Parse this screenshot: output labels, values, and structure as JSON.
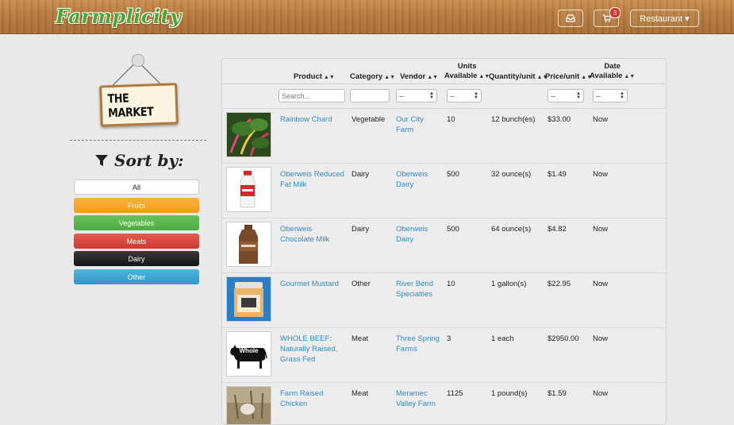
{
  "app": {
    "logo_text": "Farmplicity"
  },
  "nav": {
    "cart_count": "3",
    "role_label": "Restaurant ▾"
  },
  "sign": {
    "text": "THE MARKET"
  },
  "sidebar": {
    "sort_title": "Sort by:",
    "categories": [
      "All",
      "Fruits",
      "Vegetables",
      "Meats",
      "Dairy",
      "Other"
    ]
  },
  "table": {
    "headers": {
      "product": "Product",
      "category": "Category",
      "vendor": "Vendor",
      "units_line1": "Units",
      "units_line2": "Available",
      "qty": "Quantity/unit",
      "price": "Price/unit",
      "date_line1": "Date",
      "date_line2": "Available"
    },
    "search_placeholder": "Search...",
    "select_default": "--",
    "rows": [
      {
        "product": "Rainbow Chard",
        "category": "Vegetable",
        "vendor": "Our City Farm",
        "units": "10",
        "qty": "12 bunch(es)",
        "price": "$33.00",
        "date": "Now",
        "thumb": "chard"
      },
      {
        "product": "Oberweis Reduced Fat Milk",
        "category": "Dairy",
        "vendor": "Oberweis Dairy",
        "units": "500",
        "qty": "32 ounce(s)",
        "price": "$1.49",
        "date": "Now",
        "thumb": "milk"
      },
      {
        "product": "Oberweis Chocolate Milk",
        "category": "Dairy",
        "vendor": "Oberweis Dairy",
        "units": "500",
        "qty": "64 ounce(s)",
        "price": "$4.82",
        "date": "Now",
        "thumb": "chocmilk"
      },
      {
        "product": "Gourmet Mustard",
        "category": "Other",
        "vendor": "River Bend Specialties",
        "units": "10",
        "qty": "1 gallon(s)",
        "price": "$22.95",
        "date": "Now",
        "thumb": "mustard"
      },
      {
        "product": "WHOLE BEEF: Naturally Raised, Grass Fed",
        "category": "Meat",
        "vendor": "Three Spring Farms",
        "units": "3",
        "qty": "1 each",
        "price": "$2950.00",
        "date": "Now",
        "thumb": "cow",
        "thumb_label": "Whole"
      },
      {
        "product": "Farm Raised Chicken",
        "category": "Meat",
        "vendor": "Meramec Valley Farm",
        "units": "1125",
        "qty": "1 pound(s)",
        "price": "$1.59",
        "date": "Now",
        "thumb": "chicken"
      }
    ]
  },
  "colors": {
    "link": "#2f8ac3",
    "fruits": "#f5991c",
    "vegetables": "#4eab41",
    "meats": "#cc3b32",
    "dairy": "#151515",
    "other": "#2f99c5"
  }
}
